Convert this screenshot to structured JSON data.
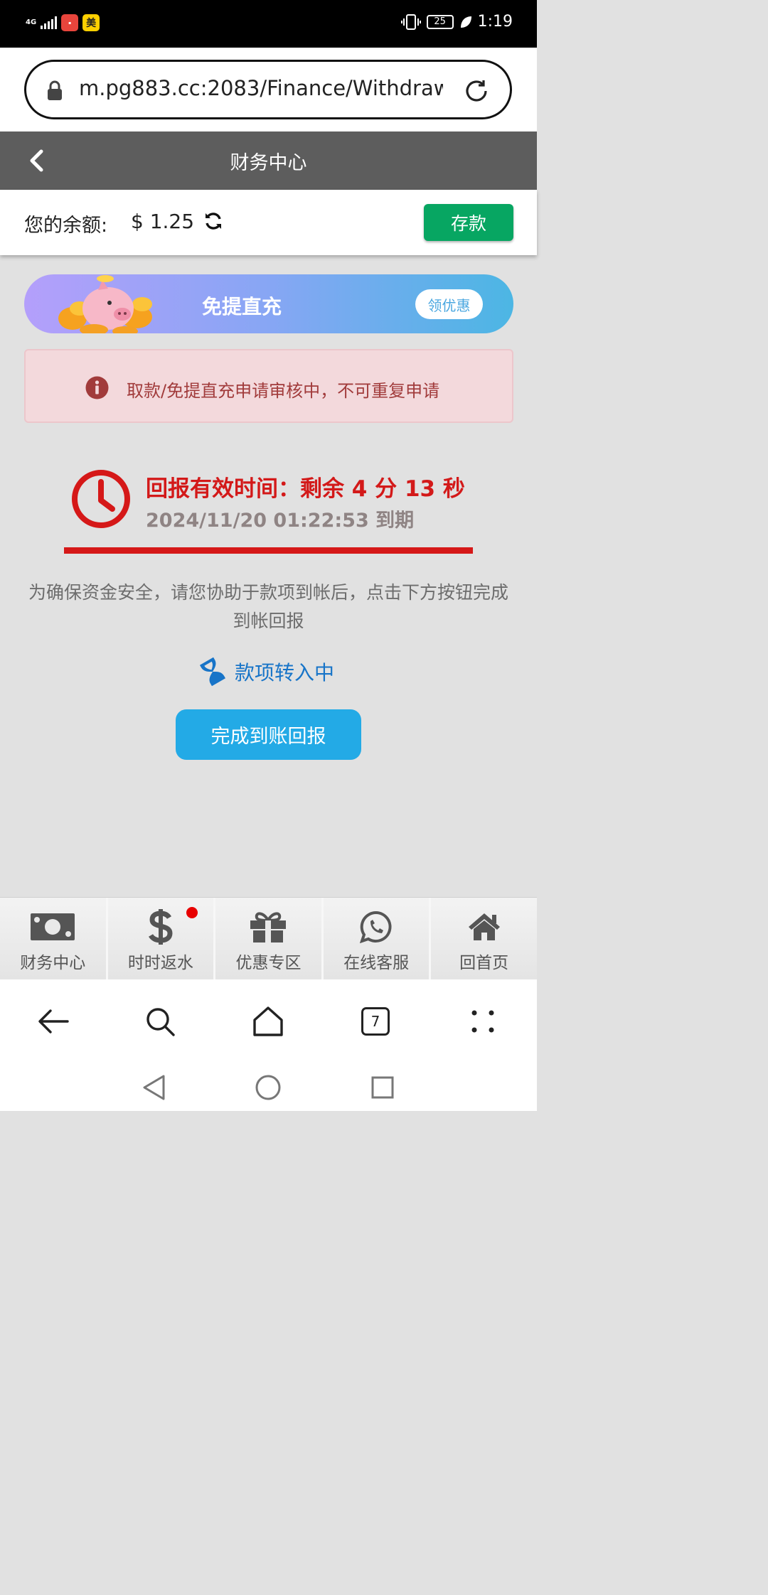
{
  "status_bar": {
    "network": "4G",
    "app_badge": "美",
    "battery": "25",
    "time": "1:19"
  },
  "browser": {
    "url": "m.pg883.cc:2083/Finance/Withdraw",
    "tab_count": "7"
  },
  "header": {
    "title": "财务中心"
  },
  "balance": {
    "label": "您的余额:",
    "value": "$ 1.25",
    "deposit_label": "存款"
  },
  "banner": {
    "title": "免提直充",
    "button_label": "领优惠"
  },
  "alert": {
    "text": "取款/免提直充申请审核中，不可重复申请"
  },
  "countdown": {
    "text": "回报有效时间：剩余 4 分 13 秒",
    "expire_text": "2024/11/20 01:22:53 到期"
  },
  "notice": {
    "text": "为确保资金安全，请您协助于款项到帐后，点击下方按钮完成到帐回报"
  },
  "transfer": {
    "status": "款项转入中"
  },
  "report_button": {
    "label": "完成到账回报"
  },
  "bottom_nav": {
    "items": [
      {
        "label": "财务中心",
        "icon": "money-bill-icon"
      },
      {
        "label": "时时返水",
        "icon": "dollar-icon"
      },
      {
        "label": "优惠专区",
        "icon": "gift-icon"
      },
      {
        "label": "在线客服",
        "icon": "whatsapp-icon"
      },
      {
        "label": "回首页",
        "icon": "home-icon"
      }
    ]
  },
  "colors": {
    "header_bg": "#5d5d5d",
    "deposit_green": "#07a662",
    "countdown_red": "#d31919",
    "report_blue": "#23aae6",
    "transfer_blue": "#1774c8"
  }
}
